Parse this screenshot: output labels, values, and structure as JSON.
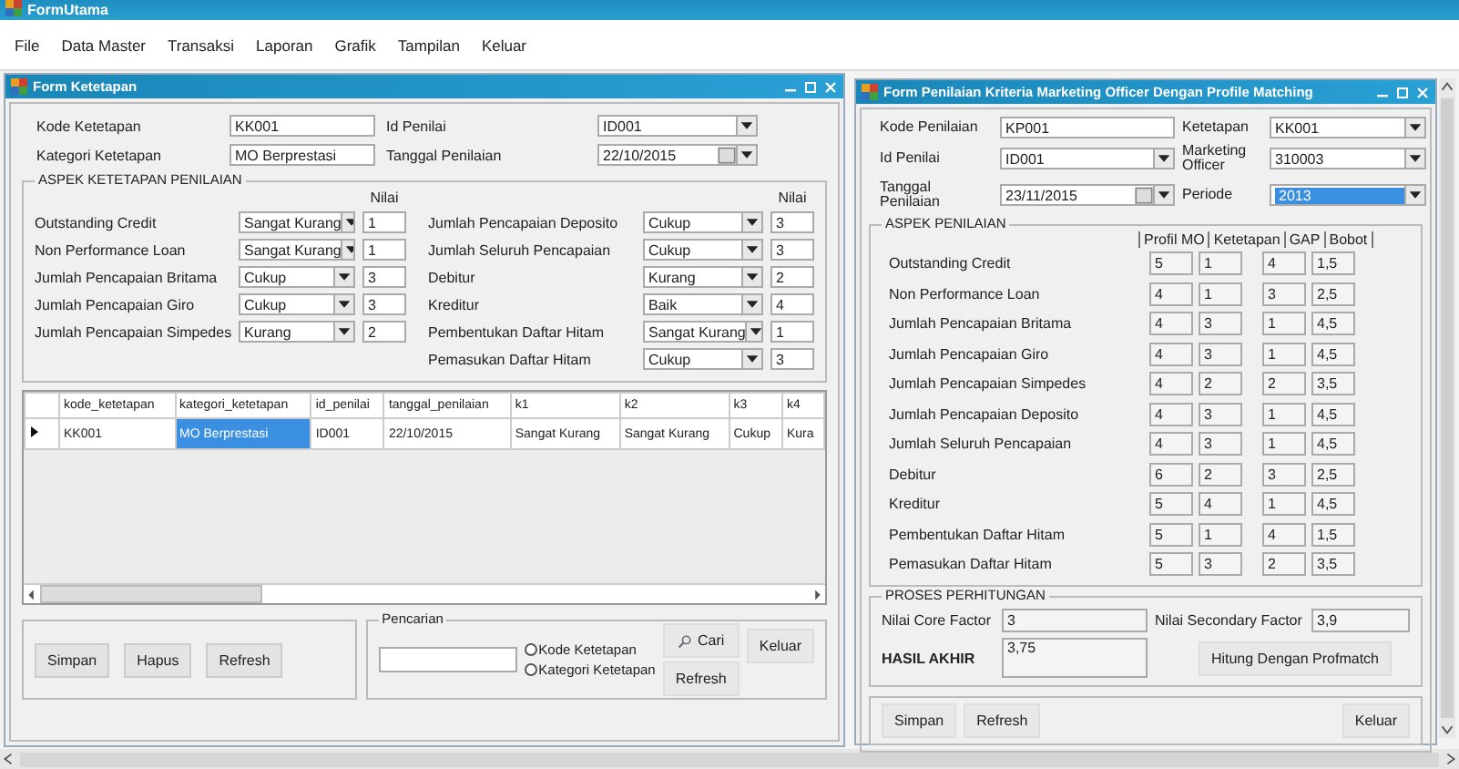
{
  "app_title": "FormUtama",
  "menu": [
    "File",
    "Data Master",
    "Transaksi",
    "Laporan",
    "Grafik",
    "Tampilan",
    "Keluar"
  ],
  "ketetapan_window": {
    "title": "Form Ketetapan",
    "fields": [
      {
        "label": "Kode Ketetapan",
        "value": "KK001",
        "kind": "text"
      },
      {
        "label": "Id Penilai",
        "value": "ID001",
        "kind": "combo"
      },
      {
        "label": "Kategori Ketetapan",
        "value": "MO Berprestasi",
        "kind": "text"
      },
      {
        "label": "Tanggal Penilaian",
        "value": "22/10/2015",
        "kind": "date"
      }
    ],
    "aspek": {
      "title": "ASPEK KETETAPAN PENILAIAN",
      "nilai_headers": [
        "Nilai",
        "Nilai"
      ],
      "left": [
        {
          "label": "Outstanding Credit",
          "value": "Sangat Kurang",
          "nilai": "1"
        },
        {
          "label": "Non Performance Loan",
          "value": "Sangat Kurang",
          "nilai": "1"
        },
        {
          "label": "Jumlah Pencapaian Britama",
          "value": "Cukup",
          "nilai": "3"
        },
        {
          "label": "Jumlah Pencapaian Giro",
          "value": "Cukup",
          "nilai": "3"
        },
        {
          "label": "Jumlah Pencapaian Simpedes",
          "value": "Kurang",
          "nilai": "2"
        }
      ],
      "right": [
        {
          "label": "Jumlah Pencapaian Deposito",
          "value": "Cukup",
          "nilai": "3"
        },
        {
          "label": "Jumlah Seluruh Pencapaian",
          "value": "Cukup",
          "nilai": "3"
        },
        {
          "label": "Debitur",
          "value": "Kurang",
          "nilai": "2"
        },
        {
          "label": "Kreditur",
          "value": "Baik",
          "nilai": "4"
        },
        {
          "label": "Pembentukan Daftar Hitam",
          "value": "Sangat Kurang",
          "nilai": "1"
        },
        {
          "label": "Pemasukan Daftar Hitam",
          "value": "Cukup",
          "nilai": "3"
        }
      ]
    },
    "table": {
      "columns": [
        "kode_ketetapan",
        "kategori_ketetapan",
        "id_penilai",
        "tanggal_penilaian",
        "k1",
        "k2",
        "k3",
        "k4"
      ],
      "rows": [
        {
          "current": true,
          "cells": [
            {
              "text": "KK001",
              "selected": false
            },
            {
              "text": "MO Berprestasi",
              "selected": true
            },
            {
              "text": "ID001",
              "selected": false
            },
            {
              "text": "22/10/2015",
              "selected": false
            },
            {
              "text": "Sangat Kurang",
              "selected": false
            },
            {
              "text": "Sangat Kurang",
              "selected": false
            },
            {
              "text": "Cukup",
              "selected": false
            },
            {
              "text": "Kura",
              "selected": false
            }
          ]
        }
      ]
    },
    "buttons": [
      "Simpan",
      "Hapus",
      "Refresh"
    ],
    "search": {
      "title": "Pencarian",
      "options": [
        {
          "label": "Kode Ketetapan",
          "selected": false
        },
        {
          "label": "Kategori Ketetapan",
          "selected": false
        }
      ],
      "search_button": "Cari",
      "refresh_button": "Refresh"
    },
    "close_button": "Keluar"
  },
  "penilaian_window": {
    "title": "Form Penilaian Kriteria Marketing Officer Dengan Profile Matching",
    "fields": [
      {
        "label": "Kode Penilaian",
        "value": "KP001",
        "kind": "text",
        "selected": false
      },
      {
        "label": "Ketetapan",
        "value": "KK001",
        "kind": "combo",
        "selected": false
      },
      {
        "label": "Id Penilai",
        "value": "ID001",
        "kind": "combo",
        "selected": false
      },
      {
        "label": "Marketing Officer",
        "value": "310003",
        "kind": "combo",
        "selected": false
      },
      {
        "label": "Tanggal Penilaian",
        "value": "23/11/2015",
        "kind": "date",
        "selected": false
      },
      {
        "label": "Periode",
        "value": "2013",
        "kind": "combo",
        "selected": true
      }
    ],
    "aspek": {
      "title": "ASPEK PENILAIAN",
      "columns": [
        "Profil MO",
        "Ketetapan",
        "GAP",
        "Bobot"
      ],
      "rows": [
        {
          "label": "Outstanding Credit",
          "values": [
            "5",
            "1",
            "4",
            "1,5"
          ]
        },
        {
          "label": "Non Performance Loan",
          "values": [
            "4",
            "1",
            "3",
            "2,5"
          ]
        },
        {
          "label": "Jumlah Pencapaian Britama",
          "values": [
            "4",
            "3",
            "1",
            "4,5"
          ]
        },
        {
          "label": "Jumlah Pencapaian Giro",
          "values": [
            "4",
            "3",
            "1",
            "4,5"
          ]
        },
        {
          "label": "Jumlah Pencapaian Simpedes",
          "values": [
            "4",
            "2",
            "2",
            "3,5"
          ]
        },
        {
          "label": "Jumlah Pencapaian Deposito",
          "values": [
            "4",
            "3",
            "1",
            "4,5"
          ]
        },
        {
          "label": "Jumlah Seluruh Pencapaian",
          "values": [
            "4",
            "3",
            "1",
            "4,5"
          ]
        },
        {
          "label": "Debitur",
          "values": [
            "6",
            "2",
            "3",
            "2,5"
          ]
        },
        {
          "label": "Kreditur",
          "values": [
            "5",
            "4",
            "1",
            "4,5"
          ]
        },
        {
          "label": "Pembentukan Daftar Hitam",
          "values": [
            "5",
            "1",
            "4",
            "1,5"
          ]
        },
        {
          "label": "Pemasukan Daftar Hitam",
          "values": [
            "5",
            "3",
            "2",
            "3,5"
          ]
        }
      ]
    },
    "proses": {
      "title": "PROSES PERHITUNGAN",
      "core_label": "Nilai Core Factor",
      "core_value": "3",
      "secondary_label": "Nilai Secondary Factor",
      "secondary_value": "3,9",
      "result_label": "HASIL AKHIR",
      "result_value": "3,75",
      "calc_button": "Hitung Dengan Profmatch"
    },
    "buttons": [
      "Simpan",
      "Refresh"
    ],
    "close_button": "Keluar"
  }
}
